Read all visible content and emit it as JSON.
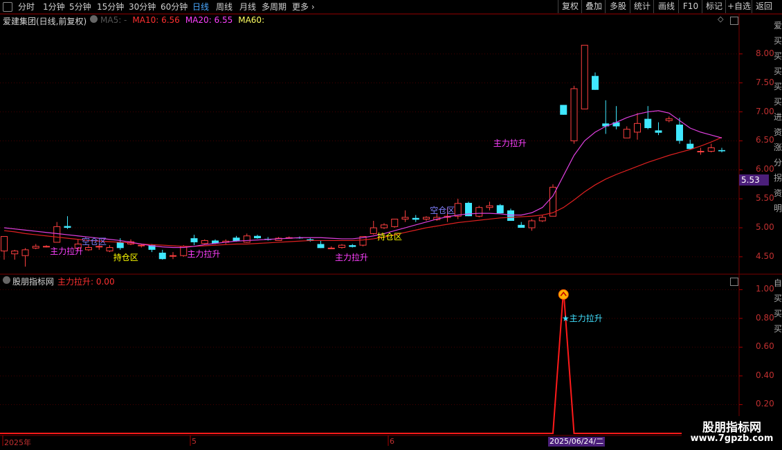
{
  "toolbar": {
    "periods": [
      "分时",
      "1分钟",
      "5分钟",
      "15分钟",
      "30分钟",
      "60分钟",
      "日线",
      "周线",
      "月线",
      "多周期",
      "更多"
    ],
    "active_period": "日线",
    "right_buttons": [
      "复权",
      "叠加",
      "多股",
      "统计",
      "画线",
      "F10",
      "标记",
      "+自选",
      "返回"
    ]
  },
  "main_chart": {
    "title": "爱建集团(日线,前复权)",
    "ma_labels": [
      {
        "text": "MA5: -",
        "color": "#555555"
      },
      {
        "text": "MA10: 6.56",
        "color": "#ff3030"
      },
      {
        "text": "MA20: 6.55",
        "color": "#ff40ff"
      },
      {
        "text": "MA60:",
        "color": "#ffff60"
      }
    ],
    "y_ticks": [
      "8.00",
      "7.50",
      "7.00",
      "6.50",
      "6.00",
      "5.50",
      "5.00",
      "4.50"
    ],
    "y_tick_values": [
      8.0,
      7.5,
      7.0,
      6.5,
      6.0,
      5.5,
      5.0,
      4.5
    ],
    "last_price": "5.53",
    "signals": [
      {
        "text": "主力拉升",
        "color": "#ff40ff",
        "bar": 5
      },
      {
        "text": "空仓区",
        "color": "#8080ff",
        "bar": 8
      },
      {
        "text": "持仓区",
        "color": "#ffff00",
        "bar": 11
      },
      {
        "text": "主力拉升",
        "color": "#ff40ff",
        "bar": 18
      },
      {
        "text": "主力拉升",
        "color": "#ff40ff",
        "bar": 32
      },
      {
        "text": "持仓区",
        "color": "#ffff00",
        "bar": 36
      },
      {
        "text": "空仓区",
        "color": "#8080ff",
        "bar": 41
      },
      {
        "text": "主力拉升",
        "color": "#ff40ff",
        "bar": 47
      }
    ],
    "right_edge_text": "爱买买买买买进资涨分拐资明"
  },
  "indicator_panel": {
    "title": "股朋指标网",
    "label": "主力拉升: 0.00",
    "annotation": "主力拉升",
    "y_ticks": [
      "1.00",
      "0.80",
      "0.60",
      "0.40",
      "0.20"
    ],
    "y_tick_values": [
      1.0,
      0.8,
      0.6,
      0.4,
      0.2
    ],
    "right_edge_text": "自买买买"
  },
  "x_axis": {
    "labels": [
      "2025年",
      "5",
      "6"
    ],
    "cursor_date": "2025/06/24/二"
  },
  "watermark": {
    "line1": "股朋指标网",
    "line2": "www.7gpzb.com"
  },
  "chart_data": {
    "type": "candlestick",
    "ylim": [
      4.2,
      8.5
    ],
    "candles": [
      {
        "o": 4.6,
        "h": 4.85,
        "l": 4.45,
        "c": 4.85
      },
      {
        "o": 4.55,
        "h": 4.62,
        "l": 4.45,
        "c": 4.6
      },
      {
        "o": 4.52,
        "h": 4.65,
        "l": 4.33,
        "c": 4.62
      },
      {
        "o": 4.65,
        "h": 4.72,
        "l": 4.63,
        "c": 4.68
      },
      {
        "o": 4.68,
        "h": 4.7,
        "l": 4.66,
        "c": 4.68
      },
      {
        "o": 4.75,
        "h": 5.1,
        "l": 4.75,
        "c": 5.02
      },
      {
        "o": 5.03,
        "h": 5.2,
        "l": 4.98,
        "c": 5.0
      },
      {
        "o": 4.65,
        "h": 4.8,
        "l": 4.6,
        "c": 4.72
      },
      {
        "o": 4.62,
        "h": 4.7,
        "l": 4.6,
        "c": 4.66
      },
      {
        "o": 4.68,
        "h": 4.72,
        "l": 4.62,
        "c": 4.68
      },
      {
        "o": 4.6,
        "h": 4.7,
        "l": 4.58,
        "c": 4.66
      },
      {
        "o": 4.75,
        "h": 4.82,
        "l": 4.62,
        "c": 4.65
      },
      {
        "o": 4.72,
        "h": 4.8,
        "l": 4.7,
        "c": 4.76
      },
      {
        "o": 4.7,
        "h": 4.72,
        "l": 4.66,
        "c": 4.7
      },
      {
        "o": 4.7,
        "h": 4.72,
        "l": 4.58,
        "c": 4.62
      },
      {
        "o": 4.57,
        "h": 4.62,
        "l": 4.45,
        "c": 4.46
      },
      {
        "o": 4.52,
        "h": 4.58,
        "l": 4.46,
        "c": 4.52
      },
      {
        "o": 4.52,
        "h": 4.7,
        "l": 4.5,
        "c": 4.68
      },
      {
        "o": 4.82,
        "h": 4.88,
        "l": 4.7,
        "c": 4.75
      },
      {
        "o": 4.73,
        "h": 4.8,
        "l": 4.72,
        "c": 4.78
      },
      {
        "o": 4.78,
        "h": 4.8,
        "l": 4.72,
        "c": 4.73
      },
      {
        "o": 4.75,
        "h": 4.8,
        "l": 4.72,
        "c": 4.77
      },
      {
        "o": 4.83,
        "h": 4.86,
        "l": 4.76,
        "c": 4.77
      },
      {
        "o": 4.75,
        "h": 4.9,
        "l": 4.74,
        "c": 4.86
      },
      {
        "o": 4.86,
        "h": 4.88,
        "l": 4.81,
        "c": 4.82
      },
      {
        "o": 4.81,
        "h": 4.84,
        "l": 4.78,
        "c": 4.79
      },
      {
        "o": 4.78,
        "h": 4.84,
        "l": 4.78,
        "c": 4.82
      },
      {
        "o": 4.83,
        "h": 4.85,
        "l": 4.82,
        "c": 4.83
      },
      {
        "o": 4.83,
        "h": 4.85,
        "l": 4.81,
        "c": 4.82
      },
      {
        "o": 4.8,
        "h": 4.82,
        "l": 4.76,
        "c": 4.78
      },
      {
        "o": 4.72,
        "h": 4.78,
        "l": 4.65,
        "c": 4.65
      },
      {
        "o": 4.65,
        "h": 4.68,
        "l": 4.64,
        "c": 4.65
      },
      {
        "o": 4.66,
        "h": 4.72,
        "l": 4.64,
        "c": 4.7
      },
      {
        "o": 4.7,
        "h": 4.72,
        "l": 4.66,
        "c": 4.67
      },
      {
        "o": 4.7,
        "h": 4.85,
        "l": 4.68,
        "c": 4.85
      },
      {
        "o": 4.9,
        "h": 5.12,
        "l": 4.88,
        "c": 5.0
      },
      {
        "o": 5.0,
        "h": 5.08,
        "l": 4.98,
        "c": 5.05
      },
      {
        "o": 5.02,
        "h": 5.15,
        "l": 5.0,
        "c": 5.15
      },
      {
        "o": 5.15,
        "h": 5.3,
        "l": 5.1,
        "c": 5.18
      },
      {
        "o": 5.17,
        "h": 5.22,
        "l": 5.1,
        "c": 5.14
      },
      {
        "o": 5.15,
        "h": 5.2,
        "l": 5.12,
        "c": 5.18
      },
      {
        "o": 5.14,
        "h": 5.24,
        "l": 5.12,
        "c": 5.18
      },
      {
        "o": 5.18,
        "h": 5.35,
        "l": 5.1,
        "c": 5.2
      },
      {
        "o": 5.2,
        "h": 5.5,
        "l": 5.15,
        "c": 5.42
      },
      {
        "o": 5.43,
        "h": 5.45,
        "l": 5.2,
        "c": 5.2
      },
      {
        "o": 5.2,
        "h": 5.38,
        "l": 5.18,
        "c": 5.35
      },
      {
        "o": 5.35,
        "h": 5.45,
        "l": 5.3,
        "c": 5.38
      },
      {
        "o": 5.39,
        "h": 5.41,
        "l": 5.25,
        "c": 5.25
      },
      {
        "o": 5.3,
        "h": 5.33,
        "l": 5.12,
        "c": 5.12
      },
      {
        "o": 5.05,
        "h": 5.1,
        "l": 5.0,
        "c": 5.0
      },
      {
        "o": 5.0,
        "h": 5.15,
        "l": 4.95,
        "c": 5.12
      },
      {
        "o": 5.12,
        "h": 5.22,
        "l": 5.1,
        "c": 5.18
      },
      {
        "o": 5.2,
        "h": 5.75,
        "l": 5.2,
        "c": 5.7
      },
      {
        "o": 7.12,
        "h": 7.12,
        "l": 6.95,
        "c": 6.95
      },
      {
        "o": 6.5,
        "h": 7.45,
        "l": 6.45,
        "c": 7.4
      },
      {
        "o": 7.05,
        "h": 8.15,
        "l": 7.05,
        "c": 8.15
      },
      {
        "o": 7.62,
        "h": 7.68,
        "l": 7.38,
        "c": 7.38
      },
      {
        "o": 6.8,
        "h": 7.2,
        "l": 6.62,
        "c": 6.75
      },
      {
        "o": 6.82,
        "h": 7.1,
        "l": 6.7,
        "c": 6.75
      },
      {
        "o": 6.55,
        "h": 6.75,
        "l": 6.55,
        "c": 6.7
      },
      {
        "o": 6.65,
        "h": 6.98,
        "l": 6.52,
        "c": 6.8
      },
      {
        "o": 6.88,
        "h": 7.1,
        "l": 6.7,
        "c": 6.72
      },
      {
        "o": 6.68,
        "h": 6.82,
        "l": 6.6,
        "c": 6.64
      },
      {
        "o": 6.85,
        "h": 6.92,
        "l": 6.82,
        "c": 6.88
      },
      {
        "o": 6.78,
        "h": 6.9,
        "l": 6.45,
        "c": 6.5
      },
      {
        "o": 6.45,
        "h": 6.52,
        "l": 6.35,
        "c": 6.36
      },
      {
        "o": 6.32,
        "h": 6.38,
        "l": 6.26,
        "c": 6.32
      },
      {
        "o": 6.32,
        "h": 6.45,
        "l": 6.3,
        "c": 6.38
      },
      {
        "o": 6.34,
        "h": 6.38,
        "l": 6.3,
        "c": 6.32
      }
    ],
    "ma10": [
      4.95,
      4.93,
      4.9,
      4.88,
      4.86,
      4.84,
      4.82,
      4.8,
      4.78,
      4.77,
      4.76,
      4.75,
      4.74,
      4.72,
      4.71,
      4.7,
      4.69,
      4.68,
      4.68,
      4.69,
      4.7,
      4.71,
      4.72,
      4.72,
      4.73,
      4.74,
      4.75,
      4.76,
      4.77,
      4.78,
      4.78,
      4.78,
      4.78,
      4.78,
      4.79,
      4.81,
      4.84,
      4.88,
      4.92,
      4.96,
      5.0,
      5.03,
      5.06,
      5.09,
      5.11,
      5.13,
      5.15,
      5.17,
      5.18,
      5.19,
      5.2,
      5.22,
      5.26,
      5.35,
      5.48,
      5.62,
      5.74,
      5.84,
      5.92,
      5.99,
      6.06,
      6.13,
      6.19,
      6.25,
      6.3,
      6.35,
      6.41,
      6.48,
      6.56
    ],
    "ma20": [
      5.0,
      4.98,
      4.96,
      4.94,
      4.92,
      4.9,
      4.88,
      4.86,
      4.84,
      4.82,
      4.8,
      4.78,
      4.75,
      4.72,
      4.69,
      4.67,
      4.66,
      4.66,
      4.68,
      4.71,
      4.73,
      4.75,
      4.77,
      4.78,
      4.79,
      4.8,
      4.81,
      4.82,
      4.83,
      4.83,
      4.83,
      4.82,
      4.81,
      4.81,
      4.83,
      4.86,
      4.9,
      4.95,
      5.0,
      5.05,
      5.1,
      5.15,
      5.19,
      5.22,
      5.24,
      5.25,
      5.25,
      5.24,
      5.22,
      5.22,
      5.26,
      5.35,
      5.55,
      5.9,
      6.25,
      6.5,
      6.65,
      6.75,
      6.82,
      6.9,
      6.96,
      7.0,
      7.02,
      6.98,
      6.85,
      6.72,
      6.65,
      6.6,
      6.55
    ],
    "indicator": [
      0,
      0,
      0,
      0,
      0,
      0,
      0,
      0,
      0,
      0,
      0,
      0,
      0,
      0,
      0,
      0,
      0,
      0,
      0,
      0,
      0,
      0,
      0,
      0,
      0,
      0,
      0,
      0,
      0,
      0,
      0,
      0,
      0,
      0,
      0,
      0,
      0,
      0,
      0,
      0,
      0,
      0,
      0,
      0,
      0,
      0,
      0,
      0,
      0,
      0,
      0,
      0,
      0,
      1,
      0,
      0,
      0,
      0,
      0,
      0,
      0,
      0,
      0,
      0,
      0,
      0,
      0,
      0,
      0
    ],
    "indicator_ylim": [
      0,
      1.05
    ]
  }
}
